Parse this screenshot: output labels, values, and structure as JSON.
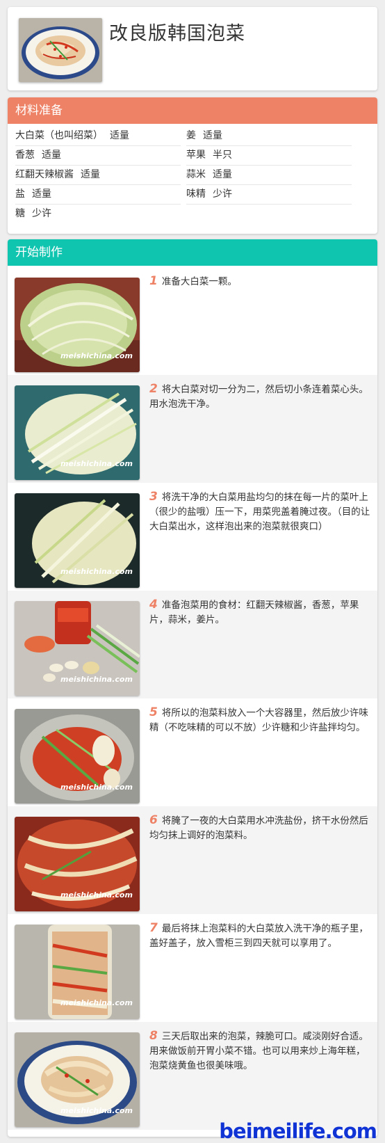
{
  "recipe": {
    "title": "改良版韩国泡菜"
  },
  "ingredients": {
    "heading": "材料准备",
    "items": [
      {
        "name": "大白菜（也叫绍菜）",
        "amount": "适量"
      },
      {
        "name": "姜",
        "amount": "适量"
      },
      {
        "name": "香葱",
        "amount": "适量"
      },
      {
        "name": "苹果",
        "amount": "半只"
      },
      {
        "name": "红翻天辣椒酱",
        "amount": "适量"
      },
      {
        "name": "蒜米",
        "amount": "适量"
      },
      {
        "name": "盐",
        "amount": "适量"
      },
      {
        "name": "味精",
        "amount": "少许"
      },
      {
        "name": "糖",
        "amount": "少许"
      }
    ]
  },
  "steps": {
    "heading": "开始制作",
    "watermark": "meishichina.com",
    "items": [
      {
        "num": "1",
        "text": "准备大白菜一颗。"
      },
      {
        "num": "2",
        "text": "将大白菜对切一分为二，然后切小条连着菜心头。用水泡洗干净。"
      },
      {
        "num": "3",
        "text": "将洗干净的大白菜用盐均匀的抹在每一片的菜叶上（很少的盐哦）压一下，用菜兜盖着腌过夜。（目的让大白菜出水，这样泡出来的泡菜就很爽口）"
      },
      {
        "num": "4",
        "text": "准备泡菜用的食材：红翻天辣椒酱，香葱，苹果片，蒜米，姜片。"
      },
      {
        "num": "5",
        "text": "将所以的泡菜料放入一个大容器里，然后放少许味精（不吃味精的可以不放）少许糖和少许盐拌均匀。"
      },
      {
        "num": "6",
        "text": "将腌了一夜的大白菜用水冲洗盐份，挤干水份然后均匀抹上调好的泡菜料。"
      },
      {
        "num": "7",
        "text": "最后将抹上泡菜料的大白菜放入洗干净的瓶子里，盖好盖子，放入雪柜三到四天就可以享用了。"
      },
      {
        "num": "8",
        "text": "三天后取出来的泡菜，辣脆可口。咸淡刚好合适。用来做饭前开胃小菜不错。也可以用来炒上海年糕，泡菜烧黄鱼也很美味哦。"
      }
    ]
  },
  "footer": {
    "site": "beimeilife.com"
  }
}
